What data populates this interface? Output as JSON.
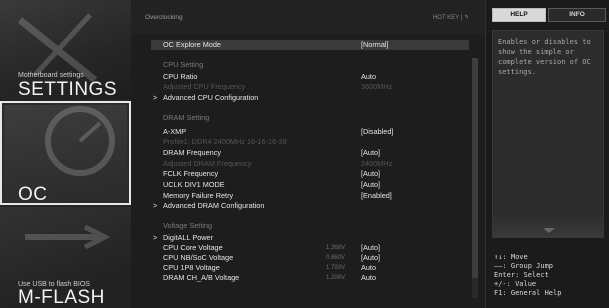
{
  "sidebar": {
    "settings": {
      "subtitle": "Motherboard settings",
      "title": "SETTINGS"
    },
    "oc": {
      "title": "OC"
    },
    "mflash": {
      "subtitle": "Use USB to flash BIOS",
      "title": "M-FLASH"
    }
  },
  "header": {
    "title": "Overclocking",
    "hotkey": "HOT KEY  |  ↰"
  },
  "rows": [
    {
      "type": "item",
      "label": "OC Explore Mode",
      "value": "[Normal]",
      "highlight": true
    },
    {
      "type": "section",
      "label": "CPU  Setting"
    },
    {
      "type": "item",
      "label": "CPU Ratio",
      "value": "Auto"
    },
    {
      "type": "disabled",
      "label": "Adjusted CPU Frequency",
      "value": "3600MHz"
    },
    {
      "type": "submenu",
      "label": "Advanced CPU Configuration"
    },
    {
      "type": "section",
      "label": "DRAM  Setting"
    },
    {
      "type": "item",
      "label": "A-XMP",
      "value": "[Disabled]"
    },
    {
      "type": "disabled",
      "label": "Profile1: DDR4 2400MHz 16-16-16-39",
      "value": ""
    },
    {
      "type": "item",
      "label": "DRAM Frequency",
      "value": "[Auto]"
    },
    {
      "type": "disabled",
      "label": "Adjusted DRAM Frequency",
      "value": "2400MHz"
    },
    {
      "type": "item",
      "label": "FCLK Frequency",
      "value": "[Auto]"
    },
    {
      "type": "item",
      "label": "UCLK DIV1 MODE",
      "value": "[Auto]"
    },
    {
      "type": "item",
      "label": "Memory Failure Retry",
      "value": "[Enabled]"
    },
    {
      "type": "submenu",
      "label": "Advanced DRAM Configuration"
    },
    {
      "type": "section",
      "label": "Voltage  Setting"
    },
    {
      "type": "submenu",
      "label": "DigitALL Power"
    },
    {
      "type": "item",
      "label": "CPU Core Voltage",
      "mid": "1.368V",
      "value": "[Auto]"
    },
    {
      "type": "item",
      "label": "CPU NB/SoC Voltage",
      "mid": "0.860V",
      "value": "[Auto]"
    },
    {
      "type": "item",
      "label": "CPU 1P8 Voltage",
      "mid": "1.793V",
      "value": "Auto"
    },
    {
      "type": "item",
      "label": "DRAM CH_A/B Voltage",
      "mid": "1.208V",
      "value": "Auto"
    }
  ],
  "right": {
    "tabs": {
      "help": "HELP",
      "info": "INFO"
    },
    "help_text": "Enables or disables to show the simple or complete version of OC settings.",
    "keys": [
      "↑↓: Move",
      "——: Group Jump",
      "Enter: Select",
      "+/-: Value",
      "F1: General Help"
    ]
  }
}
